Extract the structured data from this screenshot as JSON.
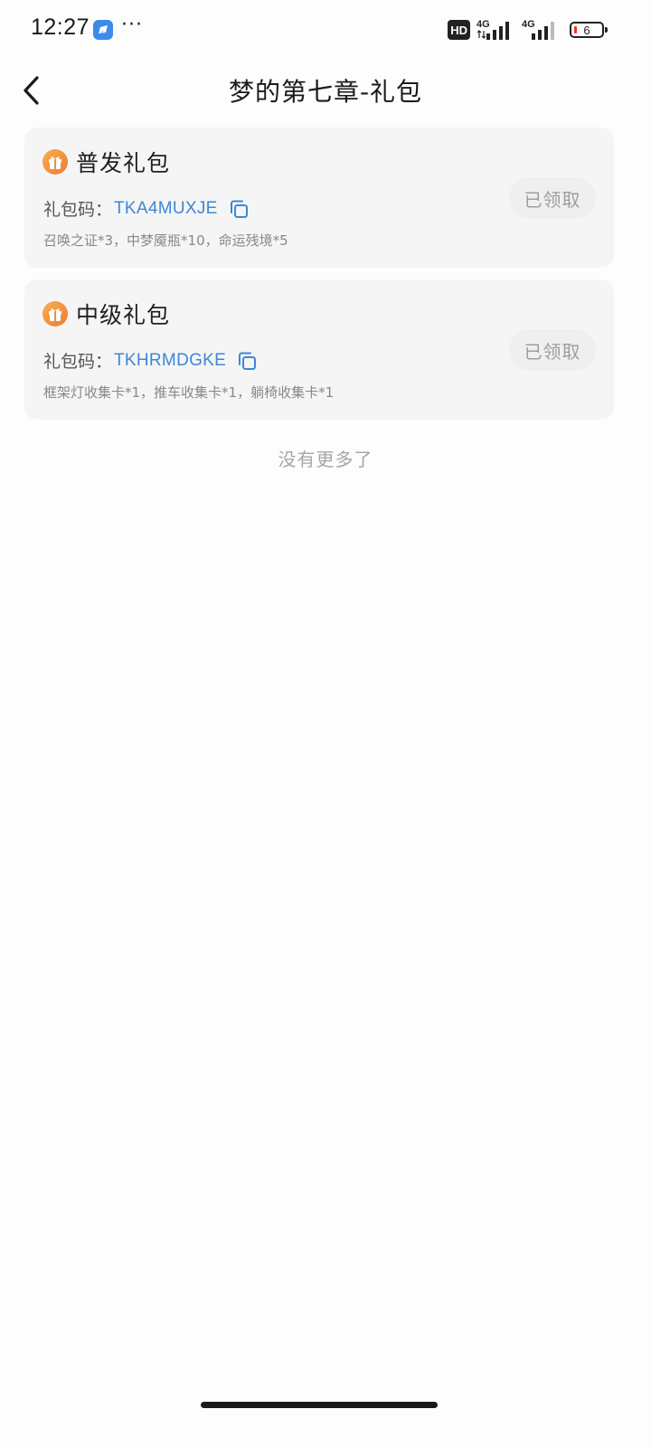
{
  "status_bar": {
    "time": "12:27",
    "app_icon": "blue-app-icon",
    "more_indicator": "···",
    "hd_badge": "HD",
    "network_1": "4G",
    "network_2": "4G",
    "battery_level": "6",
    "battery_low_color": "#e53935"
  },
  "header": {
    "back_icon": "chevron-left-icon",
    "title": "梦的第七章-礼包"
  },
  "gifts": [
    {
      "icon": "gift-icon",
      "name": "普发礼包",
      "code_label": "礼包码：",
      "code": "TKA4MUXJE",
      "copy_icon": "copy-icon",
      "contents": "召唤之证*3，中梦魇瓶*10，命运残境*5",
      "status": "已领取"
    },
    {
      "icon": "gift-icon",
      "name": "中级礼包",
      "code_label": "礼包码：",
      "code": "TKHRMDGKE",
      "copy_icon": "copy-icon",
      "contents": "框架灯收集卡*1，推车收集卡*1，躺椅收集卡*1",
      "status": "已领取"
    }
  ],
  "footer_text": "没有更多了",
  "colors": {
    "accent": "#3e86d6",
    "gift_icon": "#f0913a",
    "card_background": "#f5f5f5",
    "page_background": "#fdfdfd",
    "claimed_text": "#9e9e9e"
  }
}
